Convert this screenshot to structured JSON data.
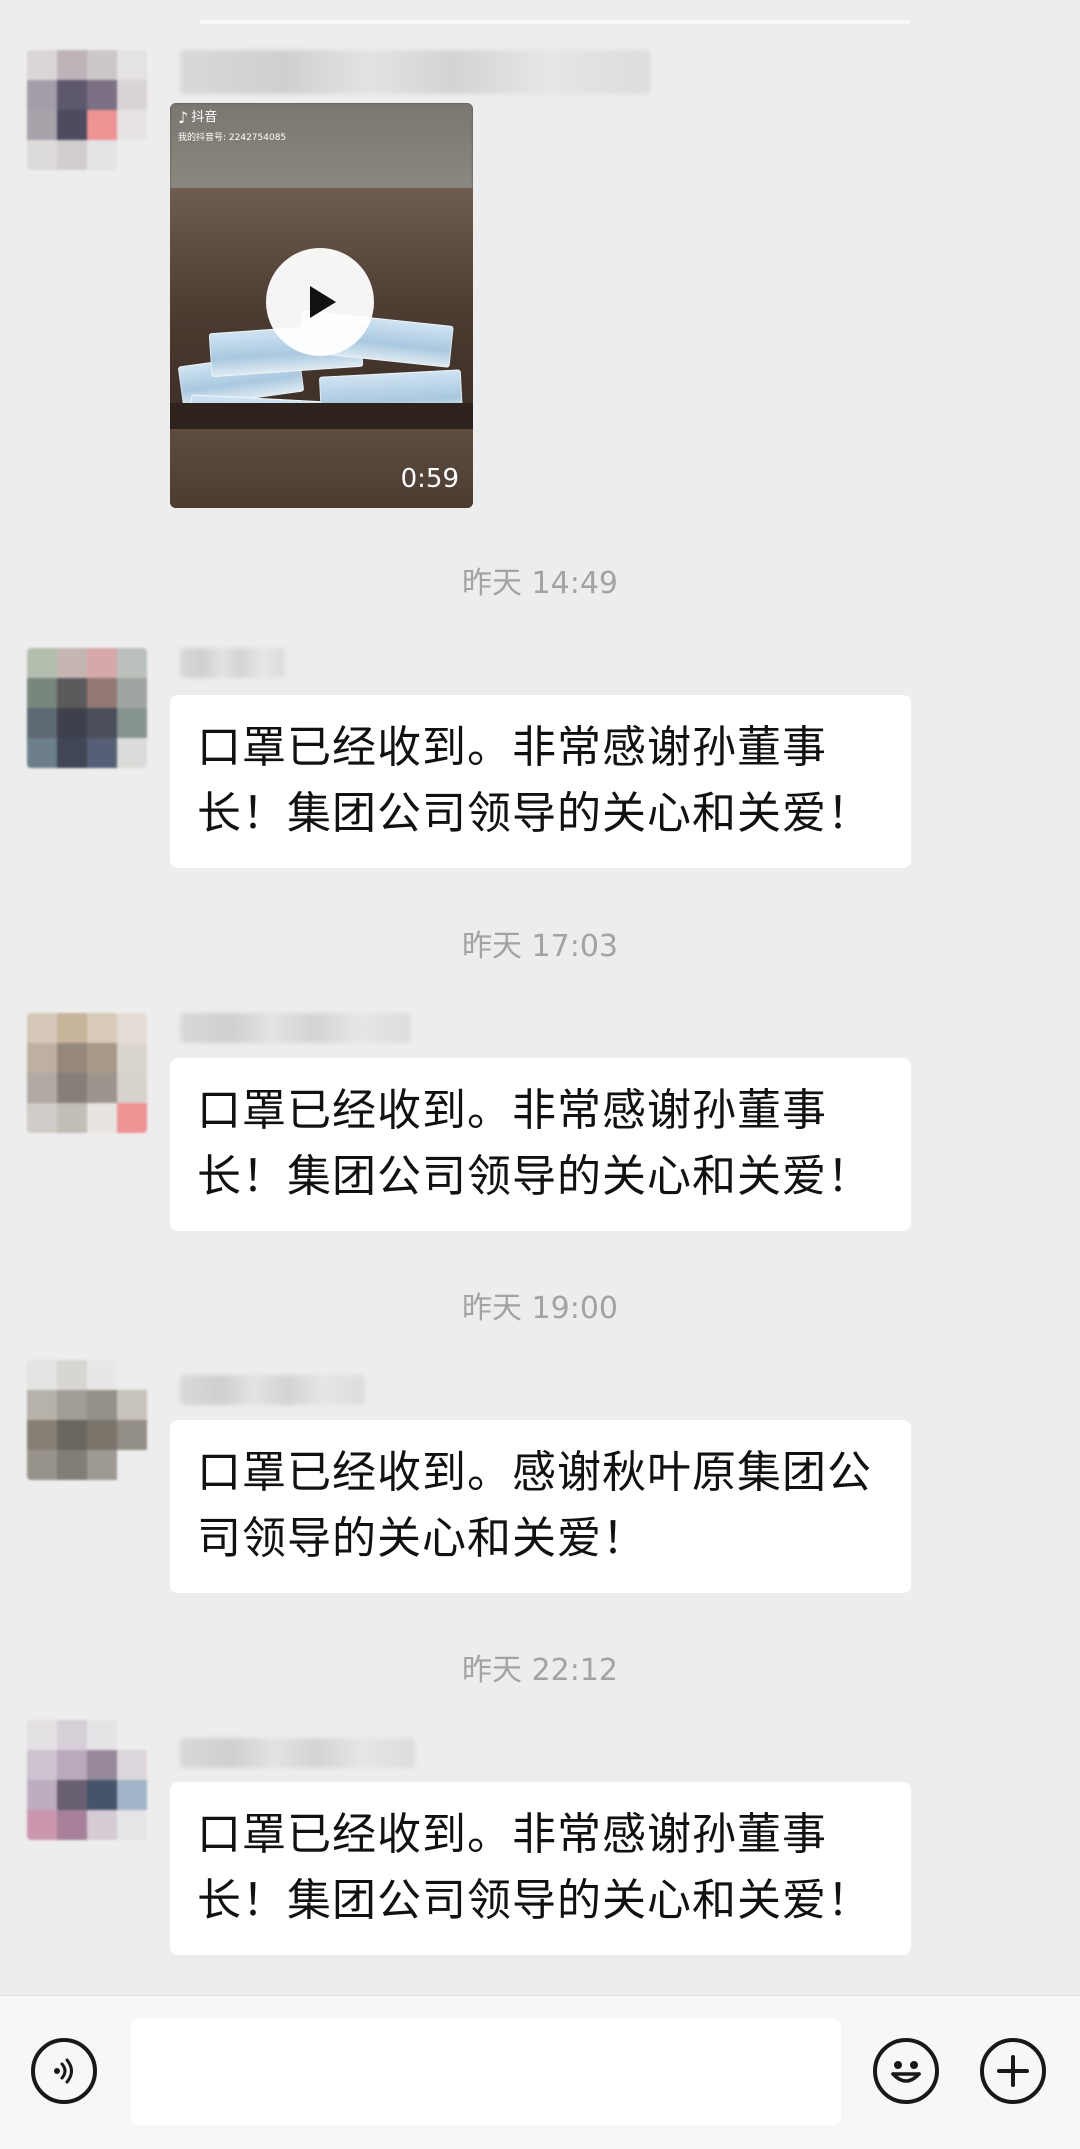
{
  "video": {
    "app_label": "抖音",
    "account_id": "我的抖音号: 2242754085",
    "duration": "0:59"
  },
  "messages": [
    {
      "time": "昨天 14:49",
      "text": "口罩已经收到。非常感谢孙董事长！集团公司领导的关心和关爱！"
    },
    {
      "time": "昨天 17:03",
      "text": "口罩已经收到。非常感谢孙董事长！集团公司领导的关心和关爱！"
    },
    {
      "time": "昨天 19:00",
      "text": "口罩已经收到。感谢秋叶原集团公司领导的关心和关爱！"
    },
    {
      "time": "昨天 22:12",
      "text": "口罩已经收到。非常感谢孙董事长！集团公司领导的关心和关爱！"
    }
  ],
  "input": {
    "value": "",
    "placeholder": ""
  },
  "icons": {
    "voice": "voice-icon",
    "emoji": "emoji-icon",
    "plus": "plus-icon",
    "play": "play-icon"
  }
}
